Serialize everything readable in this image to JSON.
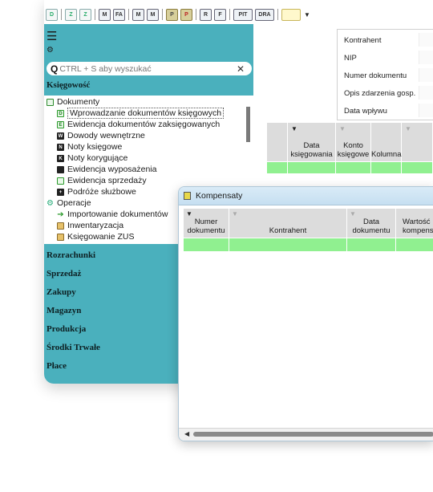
{
  "toolbar": {
    "buttons": [
      "D",
      "Z",
      "Z",
      "M",
      "FA",
      "M",
      "M",
      "P",
      "P",
      "R",
      "F",
      "PIT",
      "DRA",
      ""
    ]
  },
  "sidebar": {
    "search_placeholder": "CTRL + S aby wyszukać",
    "section_title": "Księgowość",
    "tree": [
      {
        "label": "Dokumenty",
        "icon": "folder-icon",
        "level": 0
      },
      {
        "label": "Wprowadzanie dokumentów księgowych",
        "icon": "document-icon",
        "level": 1,
        "selected": true
      },
      {
        "label": "Ewidencja dokumentów zaksięgowanych",
        "icon": "document-icon",
        "level": 1
      },
      {
        "label": "Dowody wewnętrzne",
        "icon": "internal-doc-icon",
        "level": 1
      },
      {
        "label": "Noty księgowe",
        "icon": "note-icon",
        "level": 1
      },
      {
        "label": "Noty korygujące",
        "icon": "correction-note-icon",
        "level": 1
      },
      {
        "label": "Ewidencja wyposażenia",
        "icon": "equipment-icon",
        "level": 1
      },
      {
        "label": "Ewidencja sprzedaży",
        "icon": "sales-icon",
        "level": 1
      },
      {
        "label": "Podróże służbowe",
        "icon": "travel-icon",
        "level": 1
      },
      {
        "label": "Operacje",
        "icon": "gear-icon",
        "level": 0
      },
      {
        "label": "Importowanie dokumentów",
        "icon": "import-arrow-icon",
        "level": 1
      },
      {
        "label": "Inwentaryzacja",
        "icon": "inventory-icon",
        "level": 1
      },
      {
        "label": "Księgowanie ZUS",
        "icon": "zus-icon",
        "level": 1
      }
    ],
    "categories": [
      "Rozrachunki",
      "Sprzedaż",
      "Zakupy",
      "Magazyn",
      "Produkcja",
      "Środki Trwałe",
      "Płace"
    ]
  },
  "filter_panel": {
    "fields": [
      "Kontrahent",
      "NIP",
      "Numer dokumentu",
      "Opis zdarzenia gosp.",
      "Data wpływu"
    ]
  },
  "main_grid": {
    "columns": [
      "Data księgowania",
      "Konto księgowe",
      "Kolumna"
    ]
  },
  "dialog": {
    "title": "Kompensaty",
    "columns": [
      "Numer dokumentu",
      "Kontrahent",
      "Data dokumentu",
      "Wartość kompensaty"
    ]
  }
}
